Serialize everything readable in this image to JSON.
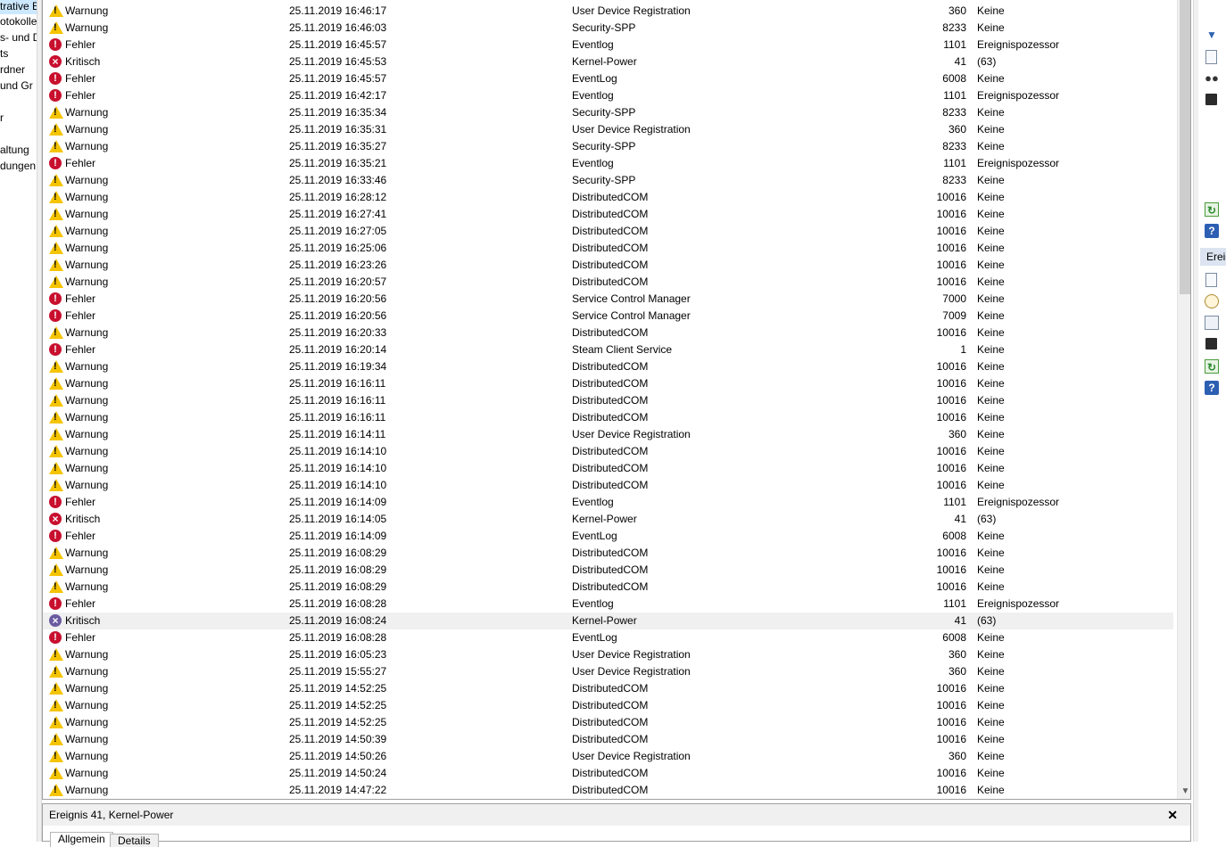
{
  "nav": {
    "items": [
      "trative E",
      "otokolle",
      "s- und D",
      "ts",
      "rdner",
      " und Gr",
      "r",
      "altung",
      "dungen"
    ]
  },
  "events": [
    {
      "level": "Warnung",
      "type": "warning",
      "date": "25.11.2019 16:46:17",
      "source": "User Device Registration",
      "id": "360",
      "task": "Keine"
    },
    {
      "level": "Warnung",
      "type": "warning",
      "date": "25.11.2019 16:46:03",
      "source": "Security-SPP",
      "id": "8233",
      "task": "Keine"
    },
    {
      "level": "Fehler",
      "type": "error",
      "date": "25.11.2019 16:45:57",
      "source": "Eventlog",
      "id": "1101",
      "task": "Ereignispozessor"
    },
    {
      "level": "Kritisch",
      "type": "critical",
      "date": "25.11.2019 16:45:53",
      "source": "Kernel-Power",
      "id": "41",
      "task": "(63)"
    },
    {
      "level": "Fehler",
      "type": "error",
      "date": "25.11.2019 16:45:57",
      "source": "EventLog",
      "id": "6008",
      "task": "Keine"
    },
    {
      "level": "Fehler",
      "type": "error",
      "date": "25.11.2019 16:42:17",
      "source": "Eventlog",
      "id": "1101",
      "task": "Ereignispozessor"
    },
    {
      "level": "Warnung",
      "type": "warning",
      "date": "25.11.2019 16:35:34",
      "source": "Security-SPP",
      "id": "8233",
      "task": "Keine"
    },
    {
      "level": "Warnung",
      "type": "warning",
      "date": "25.11.2019 16:35:31",
      "source": "User Device Registration",
      "id": "360",
      "task": "Keine"
    },
    {
      "level": "Warnung",
      "type": "warning",
      "date": "25.11.2019 16:35:27",
      "source": "Security-SPP",
      "id": "8233",
      "task": "Keine"
    },
    {
      "level": "Fehler",
      "type": "error",
      "date": "25.11.2019 16:35:21",
      "source": "Eventlog",
      "id": "1101",
      "task": "Ereignispozessor"
    },
    {
      "level": "Warnung",
      "type": "warning",
      "date": "25.11.2019 16:33:46",
      "source": "Security-SPP",
      "id": "8233",
      "task": "Keine"
    },
    {
      "level": "Warnung",
      "type": "warning",
      "date": "25.11.2019 16:28:12",
      "source": "DistributedCOM",
      "id": "10016",
      "task": "Keine"
    },
    {
      "level": "Warnung",
      "type": "warning",
      "date": "25.11.2019 16:27:41",
      "source": "DistributedCOM",
      "id": "10016",
      "task": "Keine"
    },
    {
      "level": "Warnung",
      "type": "warning",
      "date": "25.11.2019 16:27:05",
      "source": "DistributedCOM",
      "id": "10016",
      "task": "Keine"
    },
    {
      "level": "Warnung",
      "type": "warning",
      "date": "25.11.2019 16:25:06",
      "source": "DistributedCOM",
      "id": "10016",
      "task": "Keine"
    },
    {
      "level": "Warnung",
      "type": "warning",
      "date": "25.11.2019 16:23:26",
      "source": "DistributedCOM",
      "id": "10016",
      "task": "Keine"
    },
    {
      "level": "Warnung",
      "type": "warning",
      "date": "25.11.2019 16:20:57",
      "source": "DistributedCOM",
      "id": "10016",
      "task": "Keine"
    },
    {
      "level": "Fehler",
      "type": "error",
      "date": "25.11.2019 16:20:56",
      "source": "Service Control Manager",
      "id": "7000",
      "task": "Keine"
    },
    {
      "level": "Fehler",
      "type": "error",
      "date": "25.11.2019 16:20:56",
      "source": "Service Control Manager",
      "id": "7009",
      "task": "Keine"
    },
    {
      "level": "Warnung",
      "type": "warning",
      "date": "25.11.2019 16:20:33",
      "source": "DistributedCOM",
      "id": "10016",
      "task": "Keine"
    },
    {
      "level": "Fehler",
      "type": "error",
      "date": "25.11.2019 16:20:14",
      "source": "Steam Client Service",
      "id": "1",
      "task": "Keine"
    },
    {
      "level": "Warnung",
      "type": "warning",
      "date": "25.11.2019 16:19:34",
      "source": "DistributedCOM",
      "id": "10016",
      "task": "Keine"
    },
    {
      "level": "Warnung",
      "type": "warning",
      "date": "25.11.2019 16:16:11",
      "source": "DistributedCOM",
      "id": "10016",
      "task": "Keine"
    },
    {
      "level": "Warnung",
      "type": "warning",
      "date": "25.11.2019 16:16:11",
      "source": "DistributedCOM",
      "id": "10016",
      "task": "Keine"
    },
    {
      "level": "Warnung",
      "type": "warning",
      "date": "25.11.2019 16:16:11",
      "source": "DistributedCOM",
      "id": "10016",
      "task": "Keine"
    },
    {
      "level": "Warnung",
      "type": "warning",
      "date": "25.11.2019 16:14:11",
      "source": "User Device Registration",
      "id": "360",
      "task": "Keine"
    },
    {
      "level": "Warnung",
      "type": "warning",
      "date": "25.11.2019 16:14:10",
      "source": "DistributedCOM",
      "id": "10016",
      "task": "Keine"
    },
    {
      "level": "Warnung",
      "type": "warning",
      "date": "25.11.2019 16:14:10",
      "source": "DistributedCOM",
      "id": "10016",
      "task": "Keine"
    },
    {
      "level": "Warnung",
      "type": "warning",
      "date": "25.11.2019 16:14:10",
      "source": "DistributedCOM",
      "id": "10016",
      "task": "Keine"
    },
    {
      "level": "Fehler",
      "type": "error",
      "date": "25.11.2019 16:14:09",
      "source": "Eventlog",
      "id": "1101",
      "task": "Ereignispozessor"
    },
    {
      "level": "Kritisch",
      "type": "critical",
      "date": "25.11.2019 16:14:05",
      "source": "Kernel-Power",
      "id": "41",
      "task": "(63)"
    },
    {
      "level": "Fehler",
      "type": "error",
      "date": "25.11.2019 16:14:09",
      "source": "EventLog",
      "id": "6008",
      "task": "Keine"
    },
    {
      "level": "Warnung",
      "type": "warning",
      "date": "25.11.2019 16:08:29",
      "source": "DistributedCOM",
      "id": "10016",
      "task": "Keine"
    },
    {
      "level": "Warnung",
      "type": "warning",
      "date": "25.11.2019 16:08:29",
      "source": "DistributedCOM",
      "id": "10016",
      "task": "Keine"
    },
    {
      "level": "Warnung",
      "type": "warning",
      "date": "25.11.2019 16:08:29",
      "source": "DistributedCOM",
      "id": "10016",
      "task": "Keine"
    },
    {
      "level": "Fehler",
      "type": "error",
      "date": "25.11.2019 16:08:28",
      "source": "Eventlog",
      "id": "1101",
      "task": "Ereignispozessor"
    },
    {
      "level": "Kritisch",
      "type": "critical",
      "date": "25.11.2019 16:08:24",
      "source": "Kernel-Power",
      "id": "41",
      "task": "(63)",
      "selected": true
    },
    {
      "level": "Fehler",
      "type": "error",
      "date": "25.11.2019 16:08:28",
      "source": "EventLog",
      "id": "6008",
      "task": "Keine"
    },
    {
      "level": "Warnung",
      "type": "warning",
      "date": "25.11.2019 16:05:23",
      "source": "User Device Registration",
      "id": "360",
      "task": "Keine"
    },
    {
      "level": "Warnung",
      "type": "warning",
      "date": "25.11.2019 15:55:27",
      "source": "User Device Registration",
      "id": "360",
      "task": "Keine"
    },
    {
      "level": "Warnung",
      "type": "warning",
      "date": "25.11.2019 14:52:25",
      "source": "DistributedCOM",
      "id": "10016",
      "task": "Keine"
    },
    {
      "level": "Warnung",
      "type": "warning",
      "date": "25.11.2019 14:52:25",
      "source": "DistributedCOM",
      "id": "10016",
      "task": "Keine"
    },
    {
      "level": "Warnung",
      "type": "warning",
      "date": "25.11.2019 14:52:25",
      "source": "DistributedCOM",
      "id": "10016",
      "task": "Keine"
    },
    {
      "level": "Warnung",
      "type": "warning",
      "date": "25.11.2019 14:50:39",
      "source": "DistributedCOM",
      "id": "10016",
      "task": "Keine"
    },
    {
      "level": "Warnung",
      "type": "warning",
      "date": "25.11.2019 14:50:26",
      "source": "User Device Registration",
      "id": "360",
      "task": "Keine"
    },
    {
      "level": "Warnung",
      "type": "warning",
      "date": "25.11.2019 14:50:24",
      "source": "DistributedCOM",
      "id": "10016",
      "task": "Keine"
    },
    {
      "level": "Warnung",
      "type": "warning",
      "date": "25.11.2019 14:47:22",
      "source": "DistributedCOM",
      "id": "10016",
      "task": "Keine"
    }
  ],
  "detail": {
    "title": "Ereignis 41, Kernel-Power",
    "close": "✕",
    "tabs": [
      "Allgemein",
      "Details"
    ]
  },
  "actions": {
    "section_label": "Ereig",
    "icons": [
      "filter-icon",
      "properties-icon",
      "find-icon",
      "save-icon",
      "refresh-icon",
      "help-icon",
      "event-properties-icon",
      "attach-task-icon",
      "copy-icon",
      "save-selected-icon",
      "refresh-icon",
      "help-icon"
    ]
  },
  "colors": {
    "warning": "#f5c400",
    "error": "#c8102e",
    "selected_row": "#f0f0f0",
    "accent": "#2d64b0"
  }
}
